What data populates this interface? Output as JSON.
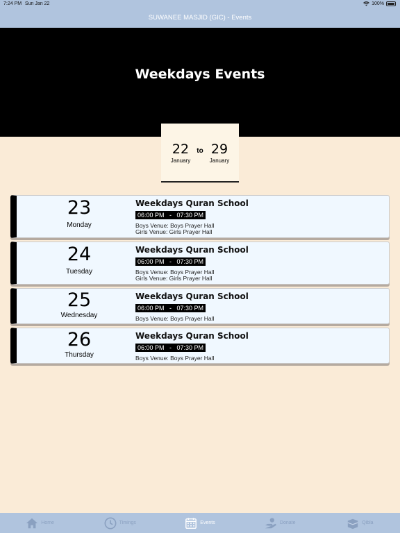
{
  "status": {
    "time": "7:24 PM",
    "date": "Sun Jan 22",
    "battery": "100%"
  },
  "nav": {
    "title": "SUWANEE MASJID (GIC) - Events"
  },
  "hero": {
    "title": "Weekdays Events"
  },
  "range": {
    "from_day": "22",
    "from_month": "January",
    "to_label": "to",
    "to_day": "29",
    "to_month": "January"
  },
  "events": [
    {
      "day": "23",
      "weekday": "Monday",
      "title": "Weekdays Quran School",
      "time": "06:00 PM   -   07:30 PM",
      "boys_venue": "Boys Venue: Boys Prayer Hall",
      "girls_venue": "Girls Venue: Girls Prayer Hall"
    },
    {
      "day": "24",
      "weekday": "Tuesday",
      "title": "Weekdays Quran School",
      "time": "06:00 PM   -   07:30 PM",
      "boys_venue": "Boys Venue: Boys Prayer Hall",
      "girls_venue": "Girls Venue: Girls Prayer Hall"
    },
    {
      "day": "25",
      "weekday": "Wednesday",
      "title": "Weekdays Quran School",
      "time": "06:00 PM   -   07:30 PM",
      "boys_venue": "Boys Venue: Boys Prayer Hall"
    },
    {
      "day": "26",
      "weekday": "Thursday",
      "title": "Weekdays Quran School",
      "time": "06:00 PM   -   07:30 PM",
      "boys_venue": "Boys Venue: Boys Prayer Hall"
    }
  ],
  "tabs": [
    {
      "label": "Home",
      "icon": "home-icon",
      "active": false
    },
    {
      "label": "Timings",
      "icon": "clock-icon",
      "active": false
    },
    {
      "label": "Events",
      "icon": "calendar-icon",
      "active": true
    },
    {
      "label": "Donate",
      "icon": "donate-hand-icon",
      "active": false
    },
    {
      "label": "Qibla",
      "icon": "kaaba-icon",
      "active": false
    }
  ],
  "colors": {
    "background": "#faebd7",
    "bars": "#b0c4de",
    "card": "#f0f8ff",
    "hero": "#000000"
  }
}
